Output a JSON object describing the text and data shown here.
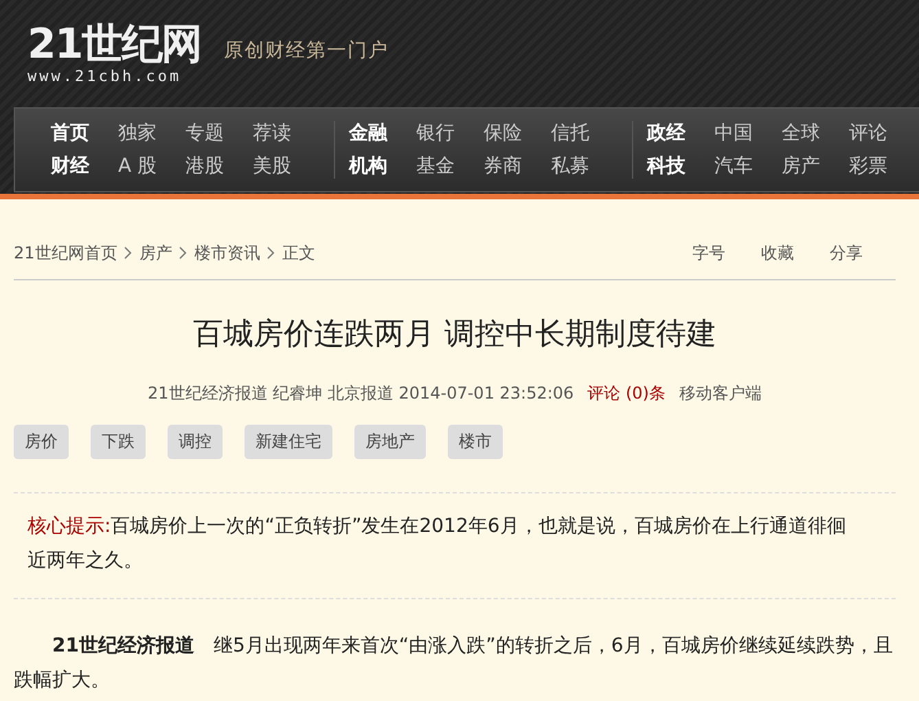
{
  "header": {
    "logo": "21世纪网",
    "url": "www.21cbh.com",
    "slogan": "原创财经第一门户"
  },
  "nav": {
    "groups": [
      {
        "rows": [
          [
            {
              "label": "首页",
              "primary": true
            },
            {
              "label": "独家",
              "primary": false
            },
            {
              "label": "专题",
              "primary": false
            },
            {
              "label": "荐读",
              "primary": false
            }
          ],
          [
            {
              "label": "财经",
              "primary": true
            },
            {
              "label": "A 股",
              "primary": false
            },
            {
              "label": "港股",
              "primary": false
            },
            {
              "label": "美股",
              "primary": false
            }
          ]
        ]
      },
      {
        "rows": [
          [
            {
              "label": "金融",
              "primary": true
            },
            {
              "label": "银行",
              "primary": false
            },
            {
              "label": "保险",
              "primary": false
            },
            {
              "label": "信托",
              "primary": false
            }
          ],
          [
            {
              "label": "机构",
              "primary": true
            },
            {
              "label": "基金",
              "primary": false
            },
            {
              "label": "券商",
              "primary": false
            },
            {
              "label": "私募",
              "primary": false
            }
          ]
        ]
      },
      {
        "rows": [
          [
            {
              "label": "政经",
              "primary": true
            },
            {
              "label": "中国",
              "primary": false
            },
            {
              "label": "全球",
              "primary": false
            },
            {
              "label": "评论",
              "primary": false
            }
          ],
          [
            {
              "label": "科技",
              "primary": true
            },
            {
              "label": "汽车",
              "primary": false
            },
            {
              "label": "房产",
              "primary": false
            },
            {
              "label": "彩票",
              "primary": false
            }
          ]
        ]
      }
    ]
  },
  "breadcrumb": [
    "21世纪网首页",
    "房产",
    "楼市资讯",
    "正文"
  ],
  "tools": [
    "字号",
    "收藏",
    "分享"
  ],
  "article": {
    "title": "百城房价连跌两月 调控中长期制度待建",
    "meta": {
      "source": "21世纪经济报道 纪睿坤 北京报道 2014-07-01 23:52:06",
      "comments": "评论 (0)条",
      "mobile": "移动客户端"
    },
    "tags": [
      "房价",
      "下跌",
      "调控",
      "新建住宅",
      "房地产",
      "楼市"
    ],
    "summary": {
      "label": "核心提示:",
      "text": "百城房价上一次的“正负转折”发生在2012年6月，也就是说，百城房价在上行通道徘徊近两年之久。"
    },
    "body": [
      {
        "dateline": "21世纪经济报道",
        "text": "继5月出现两年来首次“由涨入跌”的转折之后，6月，百城房价继续延续跌势，且跌幅扩大。"
      }
    ]
  }
}
